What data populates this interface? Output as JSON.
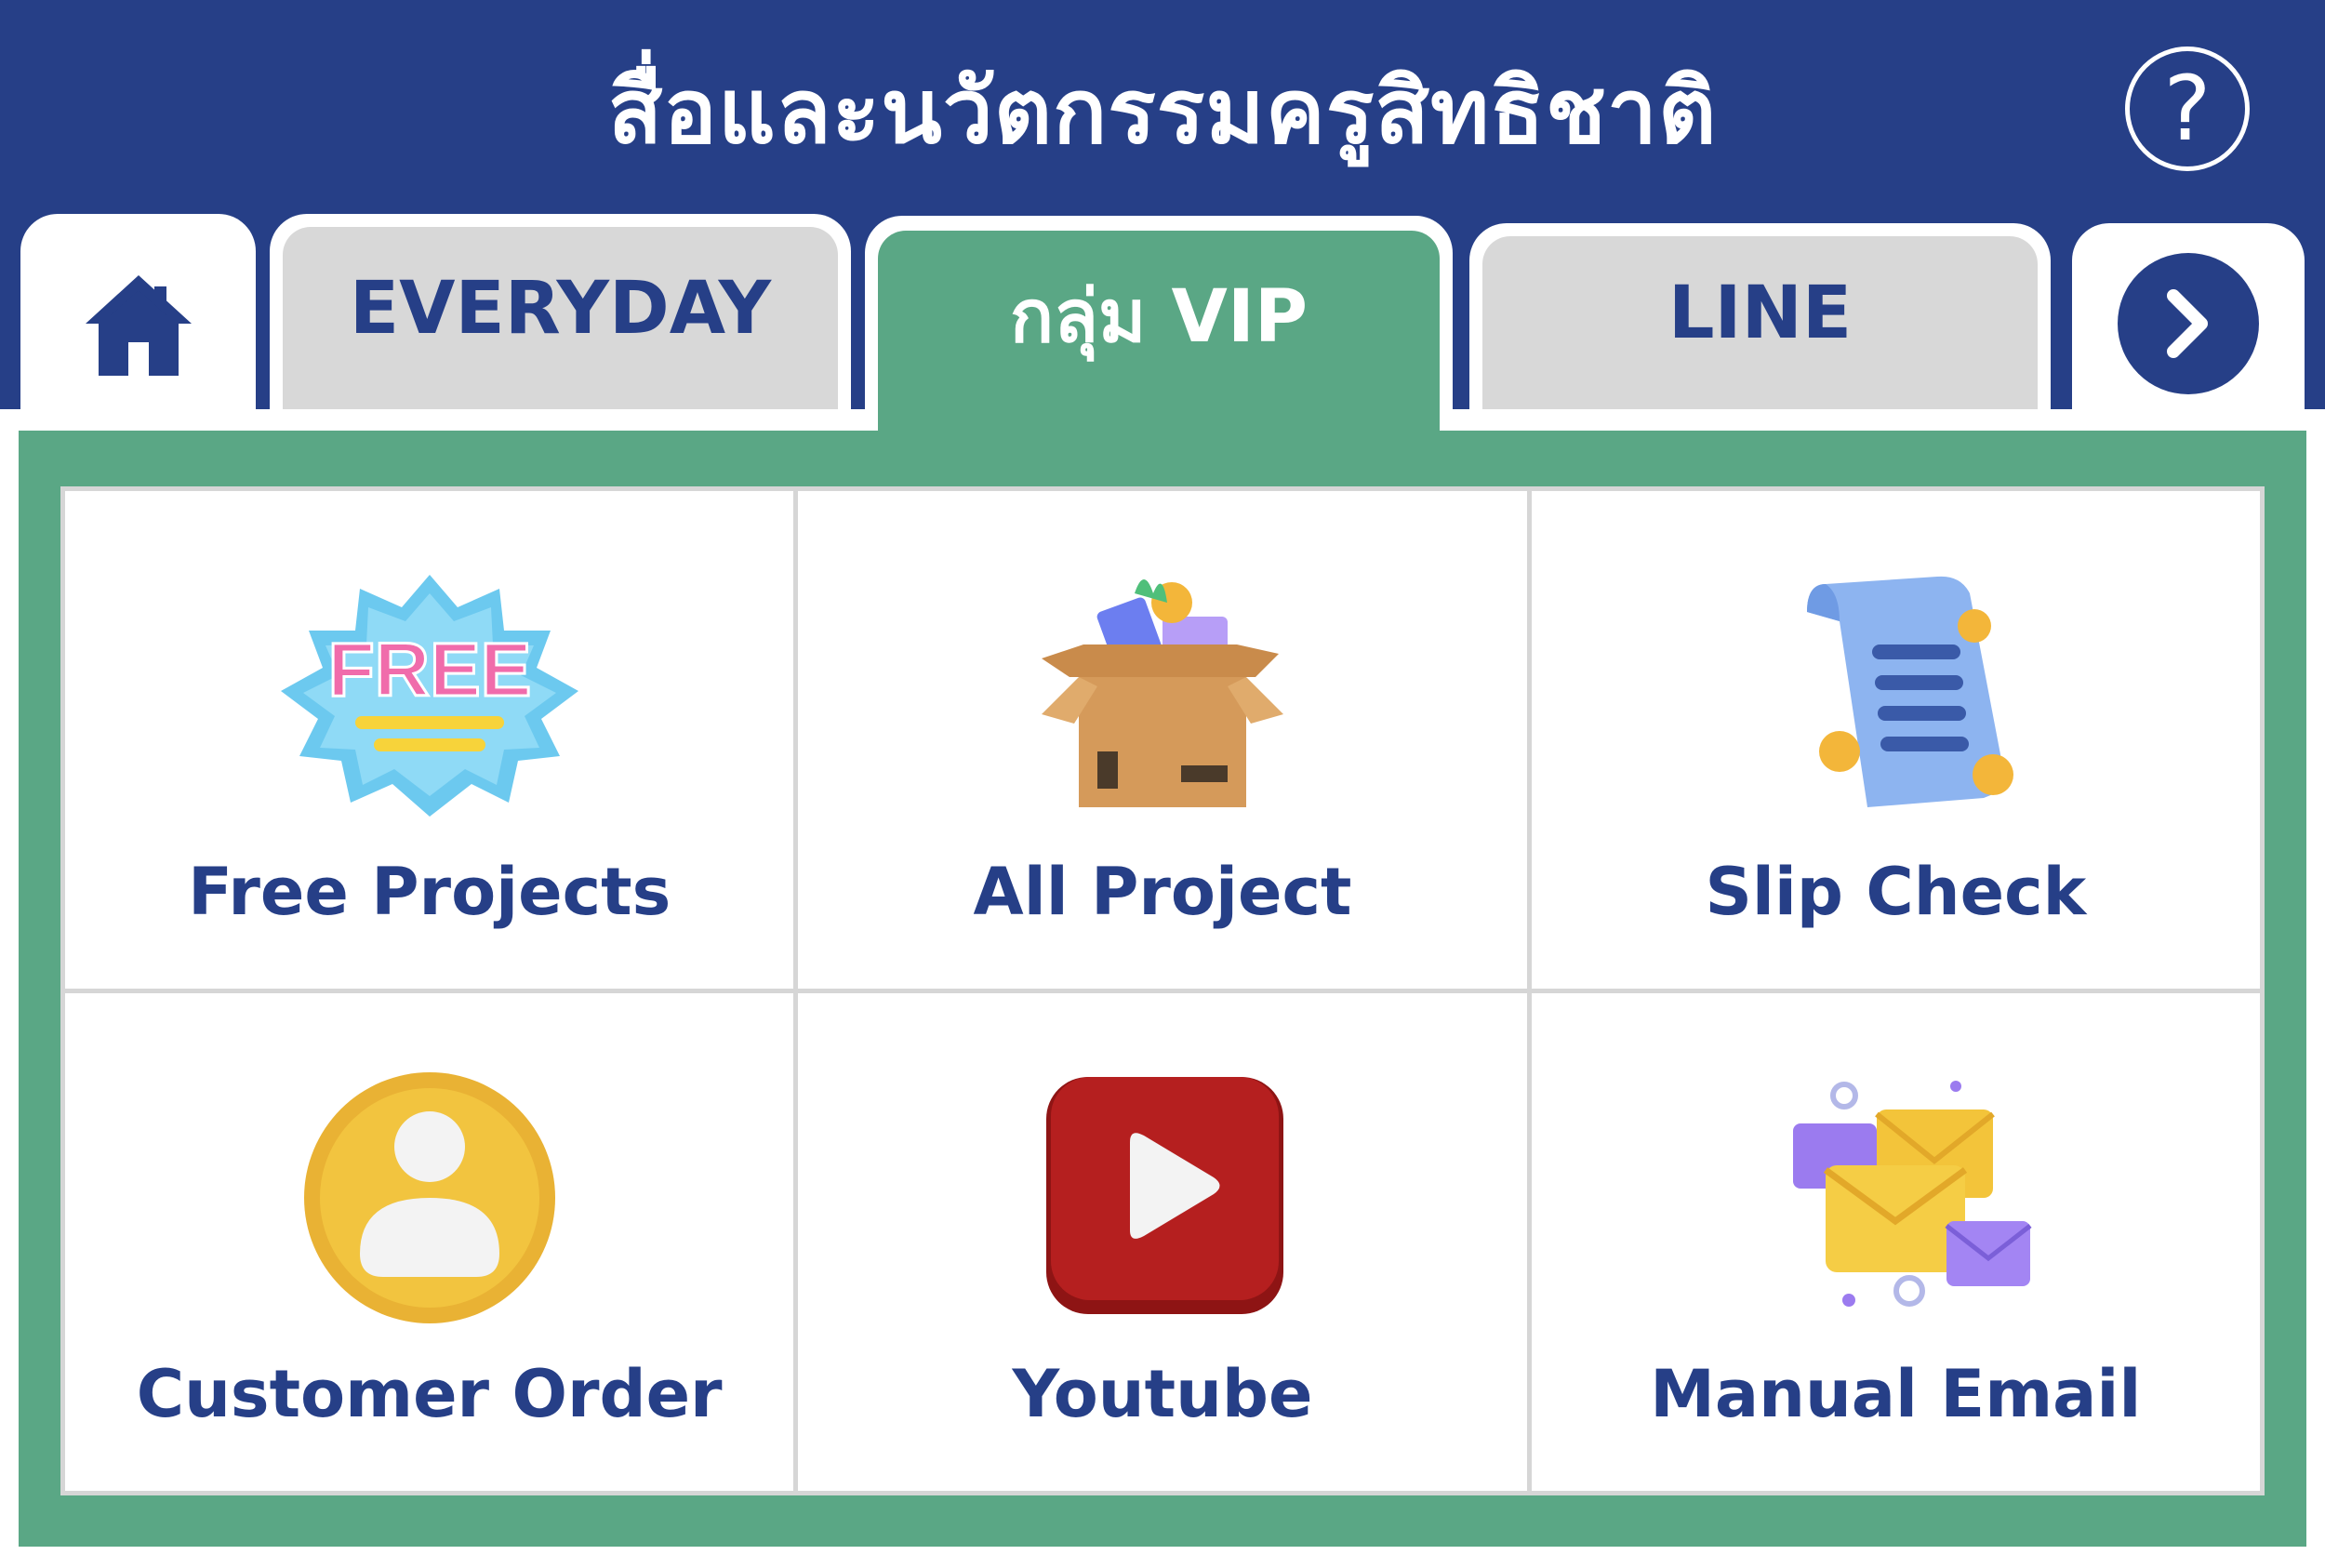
{
  "header": {
    "title": "สื่อและนวัตกรรมครูสิทธิชาติ",
    "help_icon": "?"
  },
  "tabs": [
    {
      "icon": "home-icon"
    },
    {
      "label": "EVERYDAY"
    },
    {
      "label": "กลุ่ม VIP",
      "active": true
    },
    {
      "label": "LINE"
    },
    {
      "icon": "chevron-right-icon"
    }
  ],
  "grid": [
    {
      "label": "Free Projects",
      "icon": "free-badge-icon"
    },
    {
      "label": "All Project",
      "icon": "box-icon"
    },
    {
      "label": "Slip Check",
      "icon": "receipt-icon"
    },
    {
      "label": "Customer Order",
      "icon": "user-icon"
    },
    {
      "label": "Youtube",
      "icon": "play-icon"
    },
    {
      "label": "Manual Email",
      "icon": "envelope-icon"
    }
  ],
  "colors": {
    "navy": "#263f87",
    "green": "#5aa785",
    "tab_grey": "#d8d8d8"
  }
}
